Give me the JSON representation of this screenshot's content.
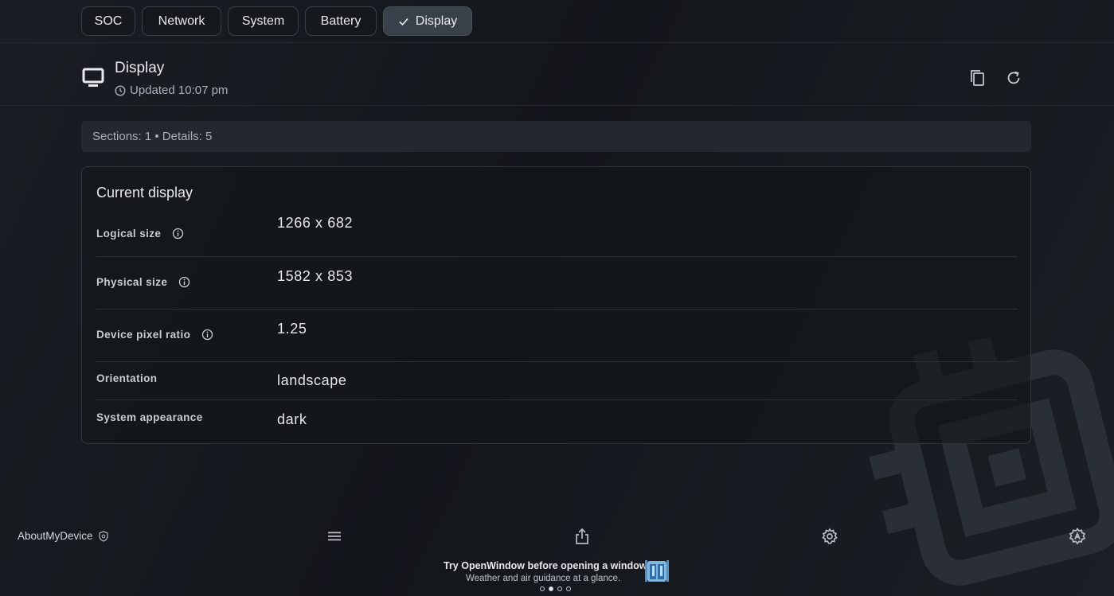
{
  "tabs": [
    {
      "label": "SOC",
      "active": false
    },
    {
      "label": "Network",
      "active": false
    },
    {
      "label": "System",
      "active": false
    },
    {
      "label": "Battery",
      "active": false
    },
    {
      "label": "Display",
      "active": true
    }
  ],
  "header": {
    "title": "Display",
    "updated": "Updated 10:07 pm",
    "icon": "monitor-icon"
  },
  "summary": "Sections: 1 • Details: 5",
  "card": {
    "title": "Current display",
    "rows": [
      {
        "label": "Logical size",
        "value": "1266 x 682",
        "info": true
      },
      {
        "label": "Physical size",
        "value": "1582 x 853",
        "info": true
      },
      {
        "label": "Device pixel ratio",
        "value": "1.25",
        "info": true
      },
      {
        "label": "Orientation",
        "value": "landscape",
        "info": false
      },
      {
        "label": "System appearance",
        "value": "dark",
        "info": false
      }
    ]
  },
  "footer": {
    "app_name": "AboutMyDevice",
    "icons": [
      "menu-icon",
      "share-icon",
      "settings-icon",
      "accessibility-settings-icon"
    ]
  },
  "promo": {
    "title": "Try OpenWindow before opening a window.",
    "subtitle": "Weather and air guidance at a glance.",
    "page_count": 4,
    "active_page": 2
  },
  "colors": {
    "background": "#15181d",
    "tab_active": "#3a4049",
    "border": "#31363d",
    "text": "#e6e8eb",
    "muted": "#aab0b8"
  }
}
